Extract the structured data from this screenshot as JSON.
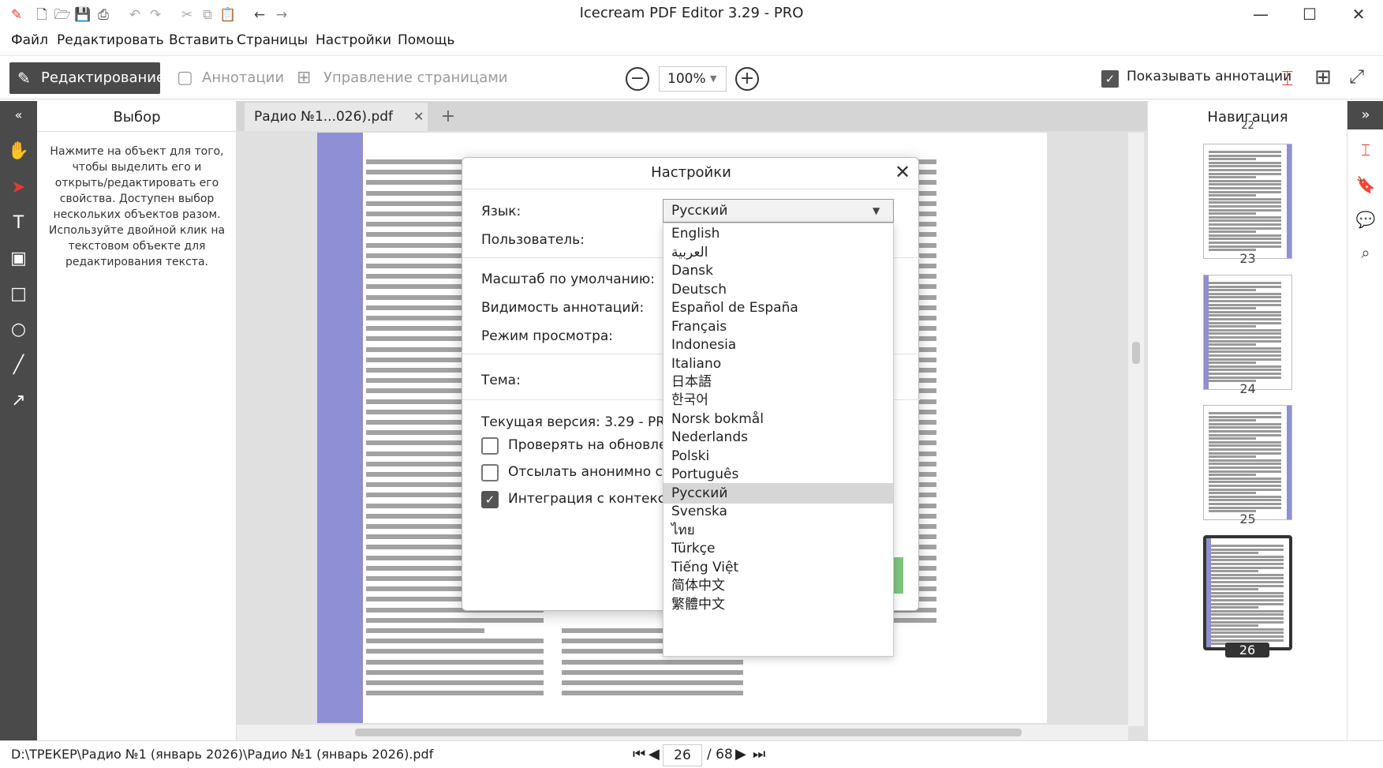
{
  "window": {
    "title": "Icecream PDF Editor 3.29 - PRO"
  },
  "menu": [
    "Файл",
    "Редактировать",
    "Вставить",
    "Страницы",
    "Настройки",
    "Помощь"
  ],
  "toolbar": {
    "mode_edit": "Редактирование",
    "mode_annot": "Аннотации",
    "mode_pages": "Управление страницами",
    "zoom": "100%",
    "show_annotations": "Показывать аннотации",
    "show_annotations_checked": true
  },
  "left_panel": {
    "title": "Выбор",
    "hint": "Нажмите на объект для того, чтобы выделить его и открыть/редактировать его свойства. Доступен выбор нескольких объектов разом. Используйте двойной клик на текстовом объекте для редактирования текста."
  },
  "tab": {
    "name": "Радио №1...026).pdf"
  },
  "right_panel": {
    "title": "Навигация",
    "pages": [
      "22",
      "23",
      "24",
      "25",
      "26"
    ]
  },
  "status": {
    "path": "D:\\ТРЕКЕР\\Радио №1 (январь 2026)\\Радио №1 (январь 2026).pdf",
    "page": "26",
    "total": "/ 68"
  },
  "dialog": {
    "title": "Настройки",
    "labels": {
      "language": "Язык:",
      "user": "Пользователь:",
      "scale": "Масштаб по умолчанию:",
      "visibility": "Видимость аннотаций:",
      "view_mode": "Режим просмотра:",
      "theme": "Тема:",
      "version": "Текущая версия: 3.29 - PRO"
    },
    "checkboxes": [
      {
        "label": "Проверять на обновлени",
        "checked": false
      },
      {
        "label": "Отсылать анонимно стат",
        "checked": false
      },
      {
        "label": "Интеграция с контекстны",
        "checked": true
      }
    ],
    "language_selected": "Русский",
    "languages": [
      "English",
      "العربية",
      "Dansk",
      "Deutsch",
      "Español de España",
      "Français",
      "Indonesia",
      "Italiano",
      "日本語",
      "한국어",
      "Norsk bokmål",
      "Nederlands",
      "Polski",
      "Português",
      "Русский",
      "Svenska",
      "ไทย",
      "Türkçe",
      "Tiếng Việt",
      "简体中文",
      "繁體中文"
    ]
  },
  "colors": {
    "accent_red": "#e03a3a",
    "dark_bar": "#4a4a4a",
    "magazine_band": "#8f8fd6"
  }
}
